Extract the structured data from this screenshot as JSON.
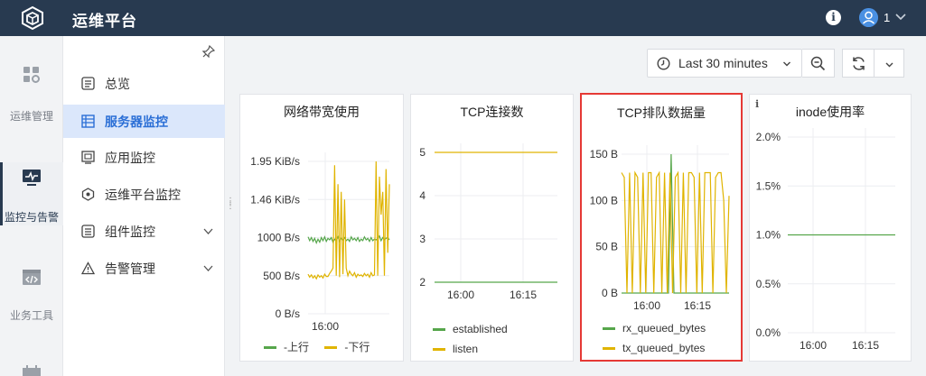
{
  "header": {
    "title": "运维平台",
    "user_count": "1"
  },
  "rail": [
    {
      "label": "运维管理",
      "icon": "dashboard-grid-icon"
    },
    {
      "label": "监控与告警",
      "icon": "monitor-icon"
    },
    {
      "label": "业务工具",
      "icon": "code-window-icon"
    }
  ],
  "subnav": [
    {
      "label": "总览"
    },
    {
      "label": "服务器监控"
    },
    {
      "label": "应用监控"
    },
    {
      "label": "运维平台监控"
    },
    {
      "label": "组件监控"
    },
    {
      "label": "告警管理"
    }
  ],
  "toolbar": {
    "time_range": "Last 30 minutes"
  },
  "panels": [
    {
      "title": "网络带宽使用",
      "legend": [
        "-上行",
        "-下行"
      ],
      "chart_data": {
        "type": "line",
        "yticks": [
          "0 B/s",
          "500 B/s",
          "1000 B/s",
          "1.46 KiB/s",
          "1.95 KiB/s"
        ],
        "xticks": [
          "16:00"
        ],
        "series": [
          {
            "name": "-上行",
            "color": "#56a64b",
            "values": [
              1010,
              960,
              1000,
              950,
              990,
              930,
              980,
              940,
              1000,
              960,
              1010,
              950,
              990,
              970,
              1000,
              940,
              980,
              960,
              1010,
              950,
              990,
              970,
              1000,
              960,
              980,
              950,
              1010,
              970,
              990,
              960,
              1000,
              950,
              980,
              960,
              1010,
              970,
              990,
              950,
              1000,
              960,
              980,
              970,
              990,
              1020,
              960,
              1000,
              970,
              990,
              1000,
              970
            ]
          },
          {
            "name": "-下行",
            "color": "#e0b400",
            "values": [
              520,
              480,
              510,
              470,
              500,
              460,
              510,
              480,
              500,
              470,
              520,
              490,
              490,
              530,
              560,
              600,
              1950,
              500,
              1700,
              480,
              1600,
              520,
              1500,
              600,
              500,
              560,
              520,
              500,
              540,
              480,
              520,
              500,
              510,
              490,
              530,
              500,
              520,
              480,
              540,
              500,
              510,
              2000,
              500,
              1800,
              1300,
              1600,
              500,
              1900,
              800,
              1700
            ]
          }
        ]
      }
    },
    {
      "title": "TCP连接数",
      "legend": [
        "established",
        "listen"
      ],
      "chart_data": {
        "type": "line",
        "yticks": [
          "2",
          "3",
          "4",
          "5"
        ],
        "xticks": [
          "16:00",
          "16:15"
        ],
        "series": [
          {
            "name": "established",
            "color": "#56a64b",
            "values": [
              2,
              2
            ]
          },
          {
            "name": "listen",
            "color": "#e0b400",
            "values": [
              5,
              5
            ]
          }
        ]
      }
    },
    {
      "title": "TCP排队数据量",
      "legend": [
        "rx_queued_bytes",
        "tx_queued_bytes"
      ],
      "chart_data": {
        "type": "line",
        "yticks": [
          "0 B",
          "50 B",
          "100 B",
          "150 B"
        ],
        "xticks": [
          "16:00",
          "16:15"
        ],
        "series": [
          {
            "name": "rx_queued_bytes",
            "color": "#56a64b",
            "values": [
              0,
              0,
              0,
              0,
              0,
              0,
              0,
              0,
              0,
              0,
              0,
              0,
              0,
              0,
              0,
              0,
              0,
              0,
              150,
              0,
              0,
              0,
              0,
              0,
              0,
              0,
              0,
              0,
              0,
              0,
              0,
              0,
              0,
              0,
              0,
              0,
              0,
              0,
              0,
              0
            ]
          },
          {
            "name": "tx_queued_bytes",
            "color": "#e0b400",
            "values": [
              130,
              125,
              0,
              130,
              0,
              130,
              125,
              0,
              130,
              0,
              130,
              130,
              0,
              125,
              130,
              0,
              130,
              0,
              130,
              0,
              125,
              130,
              0,
              130,
              0,
              130,
              130,
              125,
              0,
              130,
              0,
              130,
              130,
              130,
              0,
              125,
              130,
              130,
              100,
              0,
              105
            ]
          }
        ]
      }
    },
    {
      "title": "inode使用率",
      "info": "i",
      "legend": [],
      "chart_data": {
        "type": "line",
        "yticks": [
          "0.0%",
          "0.5%",
          "1.0%",
          "1.5%",
          "2.0%"
        ],
        "xticks": [
          "16:00",
          "16:15"
        ],
        "series": [
          {
            "color": "#56a64b",
            "values": [
              1.0,
              1.0
            ]
          }
        ]
      }
    }
  ]
}
